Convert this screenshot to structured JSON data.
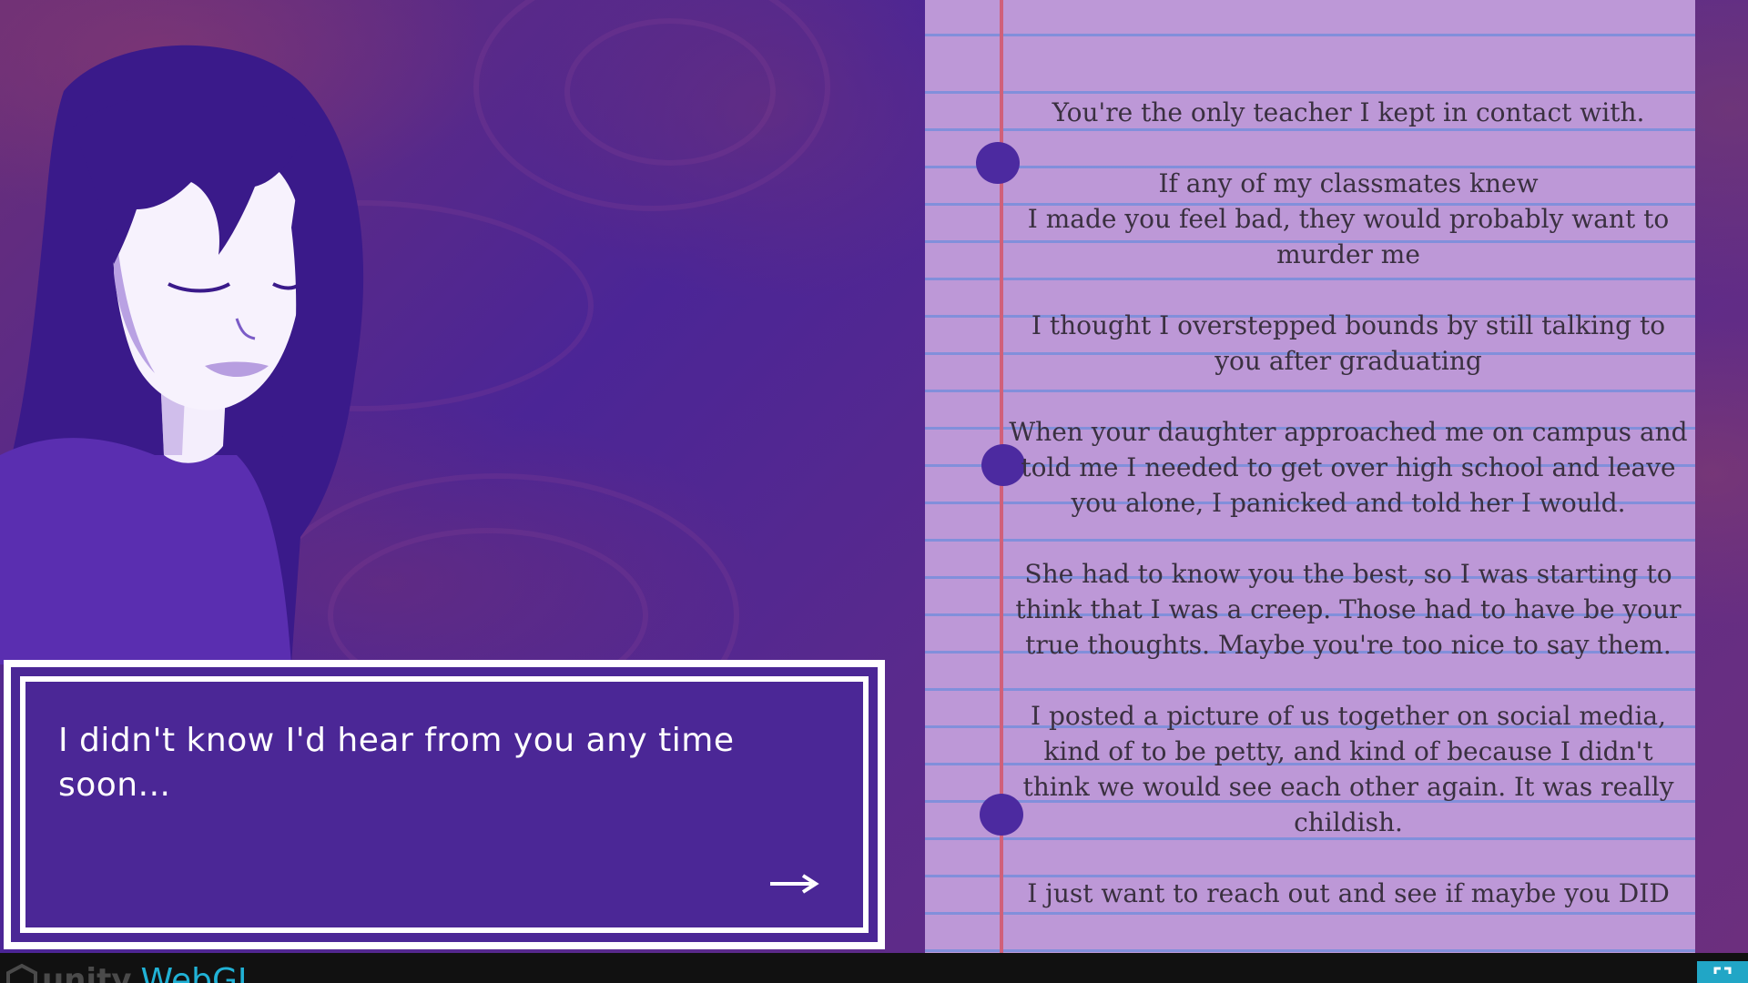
{
  "dialogue": {
    "text": "I didn't know I'd hear from you any time soon...",
    "next_icon": "right-arrow-icon"
  },
  "letter": {
    "paragraphs": [
      "You're the only teacher I kept in contact with.",
      "If any of my classmates knew\nI made you feel bad, they would probably want to murder me",
      "I thought I overstepped bounds by still talking to you after graduating",
      "When your daughter approached me on campus and told me I needed to get over high school and leave you alone, I panicked and told her I would.",
      "She had to know you the best, so I was starting to think that I was a creep. Those had to have be your true thoughts. Maybe you're too nice to say them.",
      "I posted a picture of us together on social media, kind of to be petty, and kind of because I didn't think we would see each other again. It was really childish.",
      "I just want to reach out and see if maybe you DID"
    ]
  },
  "footer": {
    "unity_label": "unity",
    "webgl_label": "WebGL",
    "fullscreen_icon": "fullscreen-icon"
  },
  "colors": {
    "paper": "#bd98d7",
    "dialogue_bg": "#4b2796",
    "accent": "#21b2d6"
  }
}
